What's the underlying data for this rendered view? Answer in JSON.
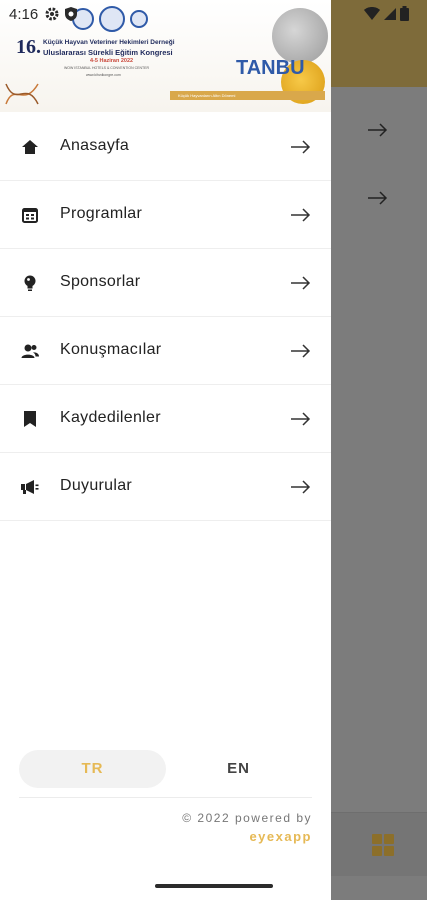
{
  "status_bar": {
    "time": "4:16",
    "icons": [
      "gear-icon",
      "shield-icon",
      "wifi-icon",
      "signal-icon",
      "battery-icon"
    ]
  },
  "banner": {
    "number": "16.",
    "line1": "Küçük Hayvan Veteriner Hekimleri Derneği",
    "line2": "Uluslararası Sürekli Eğitim Kongresi",
    "date": "4-5 Haziran 2022",
    "venue": "WOW ISTANBUL HOTELS & CONVENTION CENTER",
    "url": "www.kihvdkongre.com",
    "city_text": "TANBU",
    "tagline": "Küçük Hayvanların Altın Dönemi"
  },
  "menu": {
    "items": [
      {
        "label": "Anasayfa",
        "icon": "home-icon"
      },
      {
        "label": "Programlar",
        "icon": "calendar-icon"
      },
      {
        "label": "Sponsorlar",
        "icon": "bulb-icon"
      },
      {
        "label": "Konuşmacılar",
        "icon": "people-icon"
      },
      {
        "label": "Kaydedilenler",
        "icon": "bookmark-icon"
      },
      {
        "label": "Duyurular",
        "icon": "megaphone-icon"
      }
    ]
  },
  "language": {
    "tr": "TR",
    "en": "EN",
    "selected": "TR"
  },
  "footer": {
    "copyright": "© 2022 powered by",
    "brand": "eyexapp"
  },
  "colors": {
    "accent": "#e6b955",
    "header_gold": "#7e6b3a",
    "scrim": "#7c7c7c"
  }
}
